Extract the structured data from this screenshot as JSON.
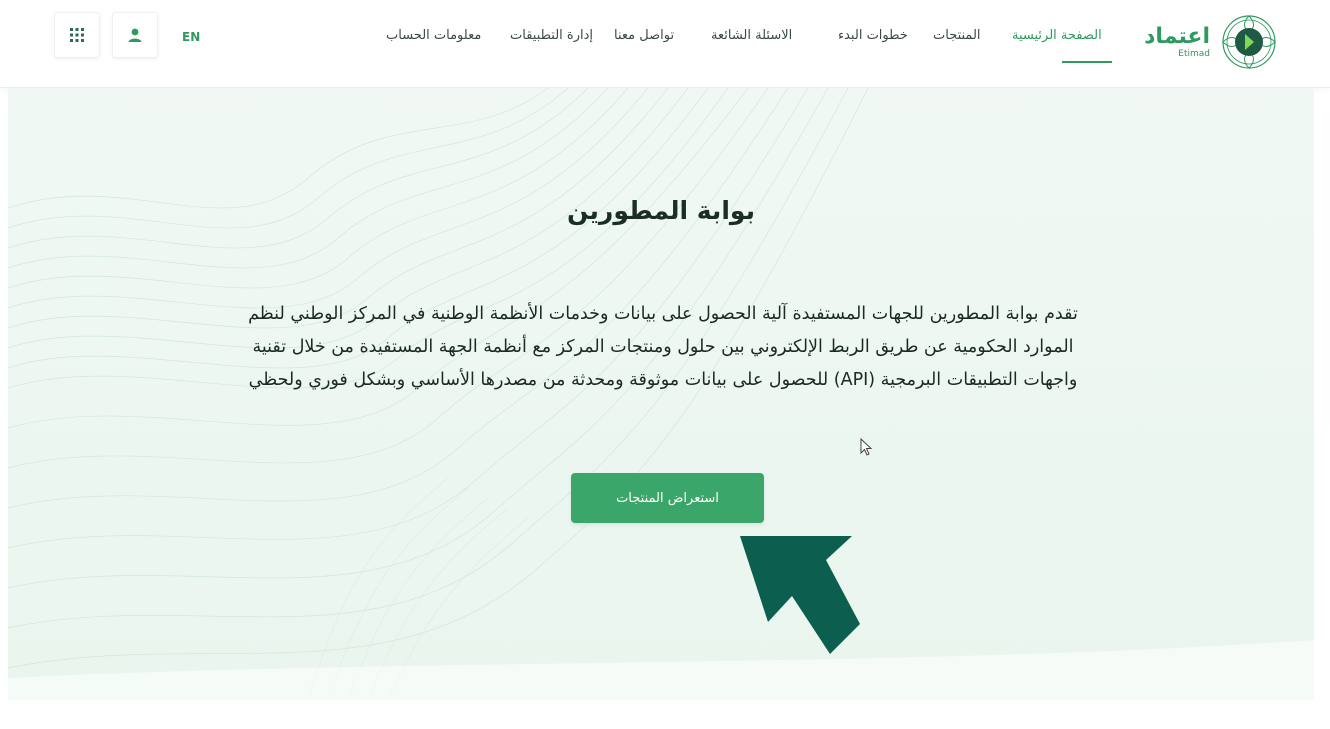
{
  "header": {
    "logo": {
      "arabic": "اعتماد",
      "english": "Etimad"
    },
    "nav": [
      {
        "label": "الصفحة الرئيسية",
        "active": true
      },
      {
        "label": "المنتجات",
        "active": false
      },
      {
        "label": "خطوات البدء",
        "active": false
      },
      {
        "label": "الاسئلة الشائعة",
        "active": false
      },
      {
        "label": "تواصل معنا",
        "active": false
      },
      {
        "label": "إدارة التطبيقات",
        "active": false
      },
      {
        "label": "معلومات الحساب",
        "active": false
      }
    ],
    "language": "EN",
    "icons": {
      "user": "user-icon",
      "apps": "apps-grid-icon"
    }
  },
  "hero": {
    "title": "بوابة المطورين",
    "description_lines": [
      "تقدم بوابة المطورين للجهات المستفيدة آلية الحصول على بيانات وخدمات الأنظمة الوطنية في المركز الوطني لنظم",
      "الموارد الحكومية عن طريق الربط الإلكتروني بين حلول ومنتجات المركز مع أنظمة الجهة المستفيدة من خلال تقنية",
      "واجهات التطبيقات البرمجية (API) للحصول على بيانات موثوقة ومحدثة من مصدرها الأساسي وبشكل فوري ولحظي"
    ],
    "cta_label": "استعراض المنتجات"
  },
  "colors": {
    "brand": "#2e9a5f",
    "button": "#3aa66a",
    "arrow": "#0c5e4f",
    "hero_bg": "#eef7f2"
  }
}
